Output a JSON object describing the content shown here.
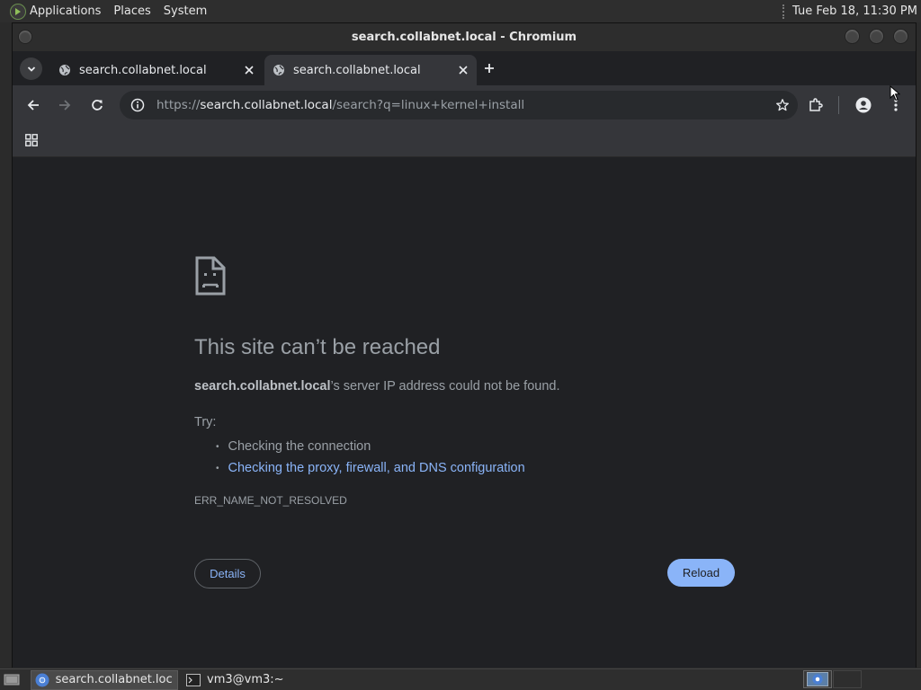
{
  "top_panel": {
    "menus": [
      "Applications",
      "Places",
      "System"
    ],
    "clock": "Tue Feb 18, 11:30 PM"
  },
  "window": {
    "title": "search.collabnet.local - Chromium"
  },
  "tabs": [
    {
      "title": "search.collabnet.local",
      "active": false
    },
    {
      "title": "search.collabnet.local",
      "active": true
    }
  ],
  "omnibox": {
    "scheme": "https://",
    "host": "search.collabnet.local",
    "path": "/search?q=linux+kernel+install"
  },
  "error_page": {
    "title": "This site can’t be reached",
    "host_bold": "search.collabnet.local",
    "description_rest": "’s server IP address could not be found.",
    "try_label": "Try:",
    "suggestions": [
      "Checking the connection",
      "Checking the proxy, firewall, and DNS configuration"
    ],
    "error_code": "ERR_NAME_NOT_RESOLVED",
    "details_label": "Details",
    "reload_label": "Reload"
  },
  "taskbar": {
    "items": [
      {
        "label": "search.collabnet.loc...",
        "icon": "chromium-icon",
        "active": true
      },
      {
        "label": "vm3@vm3:~",
        "icon": "terminal-icon",
        "active": false
      }
    ]
  },
  "colors": {
    "link": "#8ab4f8",
    "page_bg": "#202124",
    "toolbar_bg": "#35363a",
    "muted_text": "#9aa0a6"
  }
}
